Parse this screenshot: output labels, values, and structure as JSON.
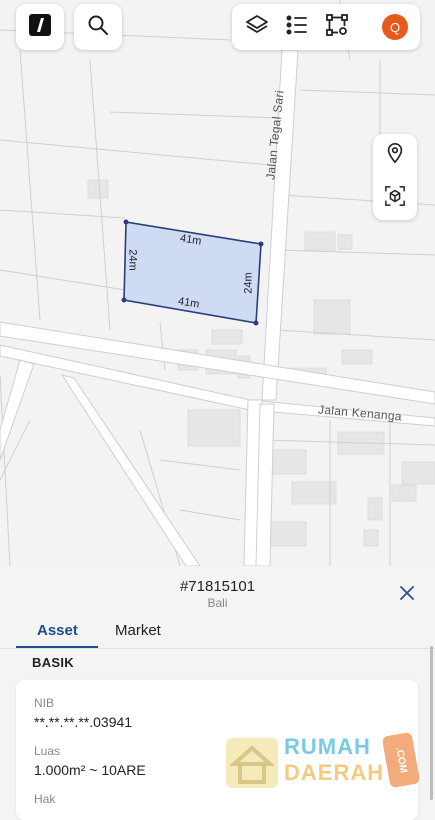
{
  "app": {
    "logo": "logo-icon",
    "toolbar": {
      "icons": [
        "layers-icon",
        "legend-list-icon",
        "polygon-edit-icon"
      ],
      "avatar_letter": "Q",
      "avatar_color": "#e65a1e"
    },
    "map_side_buttons": [
      "location-pin-icon",
      "3d-view-icon"
    ]
  },
  "map": {
    "streets": {
      "vertical": "Jalan Tegal Sari",
      "horizontal": "Jalan Kenanga"
    },
    "parcel": {
      "fill": "#cfdbf2",
      "stroke": "#2a3f7a",
      "top_length": "41m",
      "bottom_length": "41m",
      "left_length": "24m",
      "right_length": "24m"
    }
  },
  "sheet": {
    "parcel_id": "#71815101",
    "region": "Bali",
    "tabs": [
      {
        "label": "Asset",
        "active": true
      },
      {
        "label": "Market",
        "active": false
      }
    ],
    "section_title": "BASIK",
    "fields": [
      {
        "label": "NIB",
        "value": "**.**.**.**.03941"
      },
      {
        "label": "Luas",
        "value": "1.000m² ~ 10ARE"
      },
      {
        "label": "Hak",
        "value": ""
      }
    ],
    "accent_color": "#1e4f8a"
  },
  "watermark": {
    "line1": "RUMAH",
    "line2": "DAERAH",
    "suffix": ".COM"
  }
}
